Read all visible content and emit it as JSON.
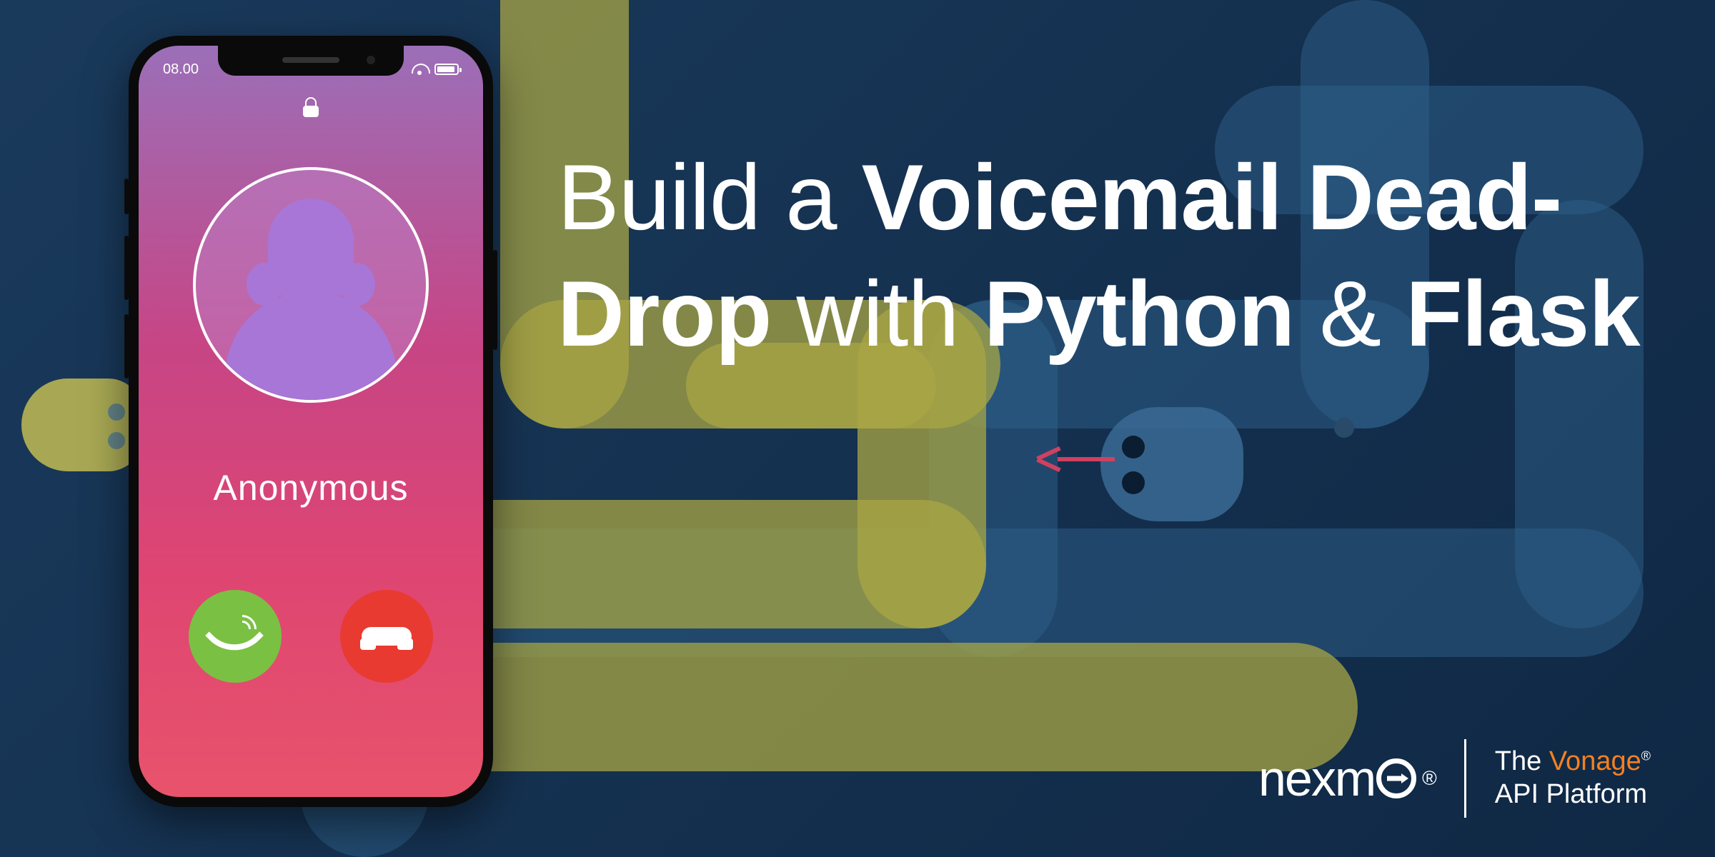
{
  "headline": {
    "part1": "Build a ",
    "part2": "Voicemail Dead-Drop",
    "part3": " with ",
    "part4": "Python",
    "part5": " & ",
    "part6": "Flask"
  },
  "phone": {
    "time": "08.00",
    "caller_name": "Anonymous",
    "lock_state": "locked",
    "icons": {
      "wifi": "wifi-icon",
      "battery": "battery-icon",
      "lock": "lock-icon",
      "accept": "phone-accept-icon",
      "decline": "phone-decline-icon"
    }
  },
  "brand": {
    "nexmo": "nexm",
    "registered": "®",
    "tagline_the": "The ",
    "tagline_vonage": "Vonage",
    "tagline_api": "API Platform"
  },
  "colors": {
    "bg_dark": "#0f2844",
    "bg_light": "#1a3a5c",
    "snake_yellow": "#a8a544",
    "snake_blue": "#2d5f8a",
    "phone_gradient_top": "#9b6fb8",
    "phone_gradient_bottom": "#e8536b",
    "accept_green": "#7ac043",
    "decline_red": "#e83a30",
    "vonage_orange": "#f58020"
  }
}
